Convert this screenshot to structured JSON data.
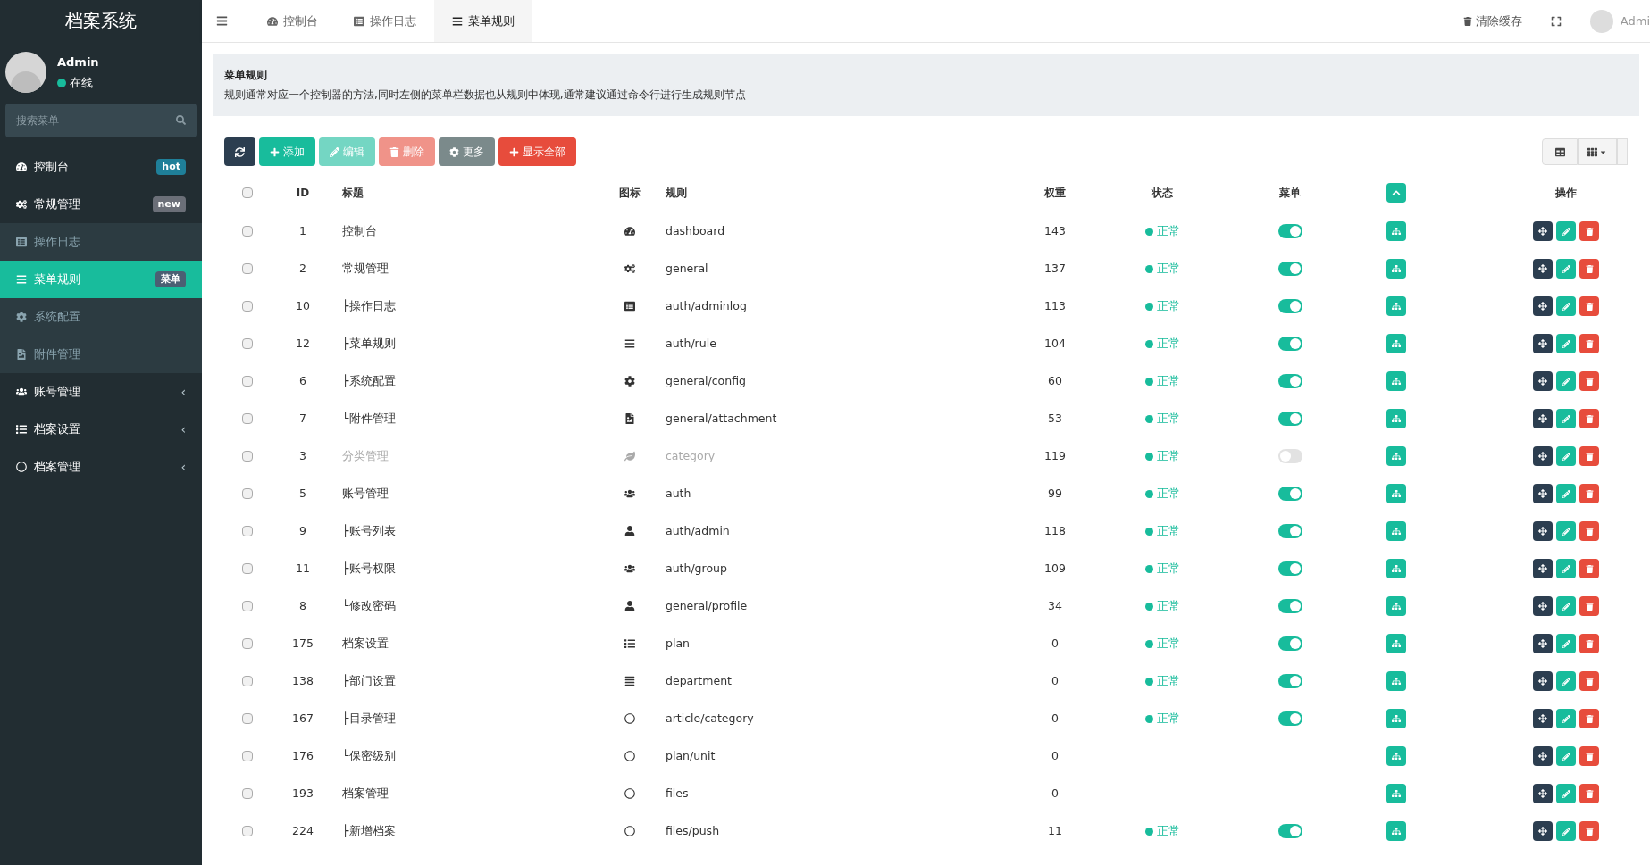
{
  "sidebar": {
    "title": "档案系统",
    "user": {
      "name": "Admin",
      "status": "在线"
    },
    "search": {
      "placeholder": "搜索菜单"
    },
    "items": [
      {
        "label": "控制台",
        "badge": {
          "text": "hot",
          "color": "#1f7f99"
        }
      },
      {
        "label": "常规管理",
        "badge": {
          "text": "new",
          "color": "#6b6f78"
        },
        "expanded": true,
        "children": [
          {
            "label": "操作日志",
            "selected": false
          },
          {
            "label": "菜单规则",
            "selected": true,
            "badge": {
              "text": "菜单",
              "color": "#4b5f73"
            }
          },
          {
            "label": "系统配置",
            "selected": false
          },
          {
            "label": "附件管理",
            "selected": false
          }
        ]
      },
      {
        "label": "账号管理",
        "caret": "‹"
      },
      {
        "label": "档案设置",
        "caret": "‹"
      },
      {
        "label": "档案管理",
        "caret": "‹"
      }
    ]
  },
  "topbar": {
    "tabs": [
      {
        "label": "控制台",
        "selected": false
      },
      {
        "label": "操作日志",
        "selected": false
      },
      {
        "label": "菜单规则",
        "selected": true
      }
    ],
    "clear_cache": "清除缓存",
    "user": "Admi"
  },
  "page_header": {
    "title": "菜单规则",
    "description": "规则通常对应一个控制器的方法,同时左侧的菜单栏数据也从规则中体现,通常建议通过命令行进行生成规则节点"
  },
  "toolbar": [
    {
      "kind": "refresh",
      "disabled": false
    },
    {
      "kind": "add",
      "label": "添加",
      "disabled": false
    },
    {
      "kind": "edit",
      "label": "编辑",
      "disabled": true
    },
    {
      "kind": "delete",
      "label": "删除",
      "disabled": true
    },
    {
      "kind": "more",
      "label": "更多",
      "disabled": false
    },
    {
      "kind": "expand",
      "label": "显示全部",
      "disabled": false
    }
  ],
  "table": {
    "select_all": {
      "checked": false
    },
    "columns": [
      "ID",
      "标题",
      "图标",
      "规则",
      "权重",
      "状态",
      "菜单",
      "操作"
    ],
    "rows": [
      {
        "id": "1",
        "title": "控制台",
        "rule": "dashboard",
        "weight": "143",
        "status": "正常",
        "menu": true,
        "disabled": false,
        "checked": false
      },
      {
        "id": "2",
        "title": "常规管理",
        "rule": "general",
        "weight": "137",
        "status": "正常",
        "menu": true,
        "disabled": false,
        "checked": false
      },
      {
        "id": "10",
        "title": "├操作日志",
        "rule": "auth/adminlog",
        "weight": "113",
        "status": "正常",
        "menu": true,
        "disabled": false,
        "checked": false
      },
      {
        "id": "12",
        "title": "├菜单规则",
        "rule": "auth/rule",
        "weight": "104",
        "status": "正常",
        "menu": true,
        "disabled": false,
        "checked": false
      },
      {
        "id": "6",
        "title": "├系统配置",
        "rule": "general/config",
        "weight": "60",
        "status": "正常",
        "menu": true,
        "disabled": false,
        "checked": false
      },
      {
        "id": "7",
        "title": "└附件管理",
        "rule": "general/attachment",
        "weight": "53",
        "status": "正常",
        "menu": true,
        "disabled": false,
        "checked": false
      },
      {
        "id": "3",
        "title": "分类管理",
        "rule": "category",
        "weight": "119",
        "status": "正常",
        "menu": false,
        "disabled": true,
        "checked": false
      },
      {
        "id": "5",
        "title": "账号管理",
        "rule": "auth",
        "weight": "99",
        "status": "正常",
        "menu": true,
        "disabled": false,
        "checked": false
      },
      {
        "id": "9",
        "title": "├账号列表",
        "rule": "auth/admin",
        "weight": "118",
        "status": "正常",
        "menu": true,
        "disabled": false,
        "checked": false
      },
      {
        "id": "11",
        "title": "├账号权限",
        "rule": "auth/group",
        "weight": "109",
        "status": "正常",
        "menu": true,
        "disabled": false,
        "checked": false
      },
      {
        "id": "8",
        "title": "└修改密码",
        "rule": "general/profile",
        "weight": "34",
        "status": "正常",
        "menu": true,
        "disabled": false,
        "checked": false
      },
      {
        "id": "175",
        "title": "档案设置",
        "rule": "plan",
        "weight": "0",
        "status": "正常",
        "menu": true,
        "disabled": false,
        "checked": false
      },
      {
        "id": "138",
        "title": "├部门设置",
        "rule": "department",
        "weight": "0",
        "status": "正常",
        "menu": true,
        "disabled": false,
        "checked": false
      },
      {
        "id": "167",
        "title": "├目录管理",
        "rule": "article/category",
        "weight": "0",
        "status": "正常",
        "menu": true,
        "disabled": false,
        "checked": false
      },
      {
        "id": "176",
        "title": "└保密级别",
        "rule": "plan/unit",
        "weight": "0",
        "disabled": false,
        "checked": false
      },
      {
        "id": "193",
        "title": "档案管理",
        "rule": "files",
        "weight": "0",
        "disabled": false,
        "checked": false
      },
      {
        "id": "224",
        "title": "├新增档案",
        "rule": "files/push",
        "weight": "11",
        "status": "正常",
        "menu": true,
        "disabled": false,
        "checked": false
      }
    ]
  }
}
